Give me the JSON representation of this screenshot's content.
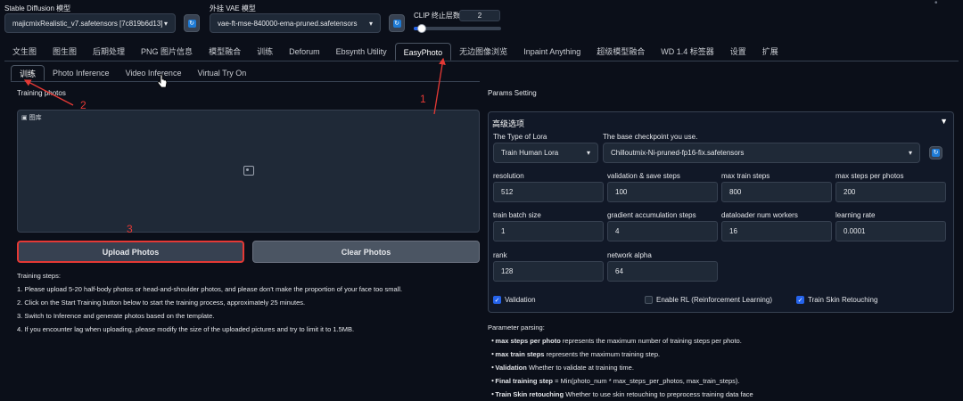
{
  "top": {
    "sd_model_label": "Stable Diffusion 模型",
    "sd_model_value": "majicmixRealistic_v7.safetensors [7c819b6d13]",
    "vae_label": "外挂 VAE 模型",
    "vae_value": "vae-ft-mse-840000-ema-pruned.safetensors",
    "clip_label": "CLIP 终止层数",
    "clip_value": "2",
    "clip_fill_fraction": 0.09
  },
  "main_tabs": [
    "文生图",
    "图生图",
    "后期处理",
    "PNG 图片信息",
    "模型融合",
    "训练",
    "Deforum",
    "Ebsynth Utility",
    "EasyPhoto",
    "无边图像浏览",
    "Inpaint Anything",
    "超级模型融合",
    "WD 1.4 标签器",
    "设置",
    "扩展"
  ],
  "active_main_tab": "EasyPhoto",
  "sub_tabs": [
    "训练",
    "Photo Inference",
    "Video Inference",
    "Virtual Try On"
  ],
  "active_sub_tab": "训练",
  "left": {
    "training_photos_label": "Training photos",
    "gallery_badge": "图库",
    "upload_label": "Upload Photos",
    "clear_label": "Clear Photos",
    "steps_title": "Training steps:",
    "steps": [
      "1. Please upload 5-20 half-body photos or head-and-shoulder photos, and please don't make the proportion of your face too small.",
      "2. Click on the Start Training button below to start the training process, approximately 25 minutes.",
      "3. Switch to Inference and generate photos based on the template.",
      "4. If you encounter lag when uploading, please modify the size of the uploaded pictures and try to limit it to 1.5MB."
    ]
  },
  "annotations": [
    "1",
    "2",
    "3"
  ],
  "right": {
    "params_label": "Params Setting",
    "advanced_title": "高级选项",
    "lora_type_label": "The Type of Lora",
    "lora_type_value": "Train Human Lora",
    "checkpoint_label": "The base checkpoint you use.",
    "checkpoint_value": "Chilloutmix-Ni-pruned-fp16-fix.safetensors",
    "fields": [
      {
        "label": "resolution",
        "value": "512"
      },
      {
        "label": "validation & save steps",
        "value": "100"
      },
      {
        "label": "max train steps",
        "value": "800"
      },
      {
        "label": "max steps per photos",
        "value": "200"
      },
      {
        "label": "train batch size",
        "value": "1"
      },
      {
        "label": "gradient accumulation steps",
        "value": "4"
      },
      {
        "label": "dataloader num workers",
        "value": "16"
      },
      {
        "label": "learning rate",
        "value": "0.0001"
      },
      {
        "label": "rank",
        "value": "128"
      },
      {
        "label": "network alpha",
        "value": "64"
      }
    ],
    "checkboxes": [
      {
        "label": "Validation",
        "checked": true
      },
      {
        "label": "Enable RL (Reinforcement Learning)",
        "checked": false
      },
      {
        "label": "Train Skin Retouching",
        "checked": true
      }
    ],
    "parsing_title": "Parameter parsing:",
    "parsing": [
      {
        "term": "max steps per photo",
        "text": " represents the maximum number of training steps per photo."
      },
      {
        "term": "max train steps",
        "text": " represents the maximum training step."
      },
      {
        "term": "Validation",
        "text": " Whether to validate at training time."
      },
      {
        "term": "Final training step",
        "text": " = Min(photo_num * max_steps_per_photos, max_train_steps)."
      },
      {
        "term": "Train Skin retouching",
        "text": " Whether to use skin retouching to preprocess training data face"
      }
    ]
  },
  "colors": {
    "bg": "#0b0f19",
    "accent": "#2563eb",
    "annotation": "#e53935"
  }
}
